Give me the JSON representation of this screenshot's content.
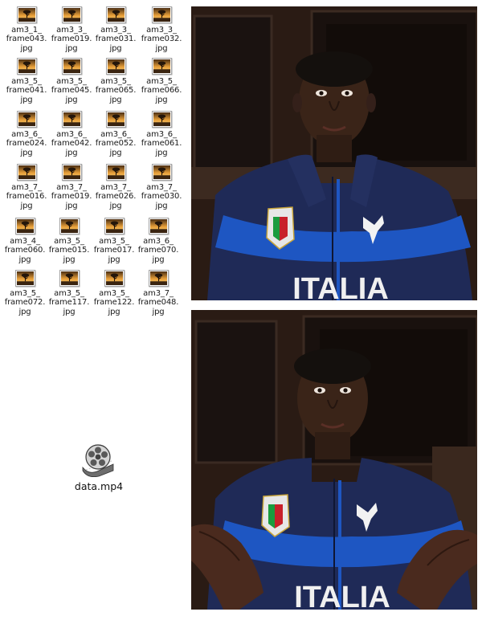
{
  "image_files": [
    {
      "name": [
        "am3_1_",
        "frame043.",
        "jpg"
      ],
      "icon": "image-thumbnail-icon"
    },
    {
      "name": [
        "am3_3_",
        "frame019.",
        "jpg"
      ],
      "icon": "image-thumbnail-icon"
    },
    {
      "name": [
        "am3_3_",
        "frame031.",
        "jpg"
      ],
      "icon": "image-thumbnail-icon"
    },
    {
      "name": [
        "am3_3_",
        "frame032.",
        "jpg"
      ],
      "icon": "image-thumbnail-icon"
    },
    {
      "name": [
        "am3_5_",
        "frame041.",
        "jpg"
      ],
      "icon": "image-thumbnail-icon"
    },
    {
      "name": [
        "am3_5_",
        "frame045.",
        "jpg"
      ],
      "icon": "image-thumbnail-icon"
    },
    {
      "name": [
        "am3_5_",
        "frame065.",
        "jpg"
      ],
      "icon": "image-thumbnail-icon"
    },
    {
      "name": [
        "am3_5_",
        "frame066.",
        "jpg"
      ],
      "icon": "image-thumbnail-icon"
    },
    {
      "name": [
        "am3_6_",
        "frame024.",
        "jpg"
      ],
      "icon": "image-thumbnail-icon"
    },
    {
      "name": [
        "am3_6_",
        "frame042.",
        "jpg"
      ],
      "icon": "image-thumbnail-icon"
    },
    {
      "name": [
        "am3_6_",
        "frame052.",
        "jpg"
      ],
      "icon": "image-thumbnail-icon"
    },
    {
      "name": [
        "am3_6_",
        "frame061.",
        "jpg"
      ],
      "icon": "image-thumbnail-icon"
    },
    {
      "name": [
        "am3_7_",
        "frame016.",
        "jpg"
      ],
      "icon": "image-thumbnail-icon"
    },
    {
      "name": [
        "am3_7_",
        "frame019.",
        "jpg"
      ],
      "icon": "image-thumbnail-icon"
    },
    {
      "name": [
        "am3_7_",
        "frame026.",
        "jpg"
      ],
      "icon": "image-thumbnail-icon"
    },
    {
      "name": [
        "am3_7_",
        "frame030.",
        "jpg"
      ],
      "icon": "image-thumbnail-icon"
    },
    {
      "name": [
        "am3_4_",
        "frame060.",
        "jpg"
      ],
      "icon": "image-thumbnail-icon"
    },
    {
      "name": [
        "am3_5_",
        "frame015.",
        "jpg"
      ],
      "icon": "image-thumbnail-icon"
    },
    {
      "name": [
        "am3_5_",
        "frame017.",
        "jpg"
      ],
      "icon": "image-thumbnail-icon"
    },
    {
      "name": [
        "am3_6_",
        "frame070.",
        "jpg"
      ],
      "icon": "image-thumbnail-icon"
    },
    {
      "name": [
        "am3_5_",
        "frame072.",
        "jpg"
      ],
      "icon": "image-thumbnail-icon"
    },
    {
      "name": [
        "am3_5_",
        "frame117.",
        "jpg"
      ],
      "icon": "image-thumbnail-icon"
    },
    {
      "name": [
        "am3_5_",
        "frame122.",
        "jpg"
      ],
      "icon": "image-thumbnail-icon"
    },
    {
      "name": [
        "am3_7_",
        "frame048.",
        "jpg"
      ],
      "icon": "image-thumbnail-icon"
    }
  ],
  "video_file": {
    "name": "data.mp4",
    "icon": "film-reel-icon"
  },
  "photos": {
    "top": {
      "jacket_text": "ITALIA",
      "subject": "person in navy and blue jacket with Italy crest, hands down"
    },
    "bottom": {
      "jacket_text": "ITALIA",
      "subject": "same person, palms raised in shrug gesture"
    }
  },
  "colors": {
    "jacket_navy": "#1f2a57",
    "jacket_blue": "#1e56c2",
    "background_wood": "#2a1b14",
    "thumb_sky": "#e8a03a"
  }
}
